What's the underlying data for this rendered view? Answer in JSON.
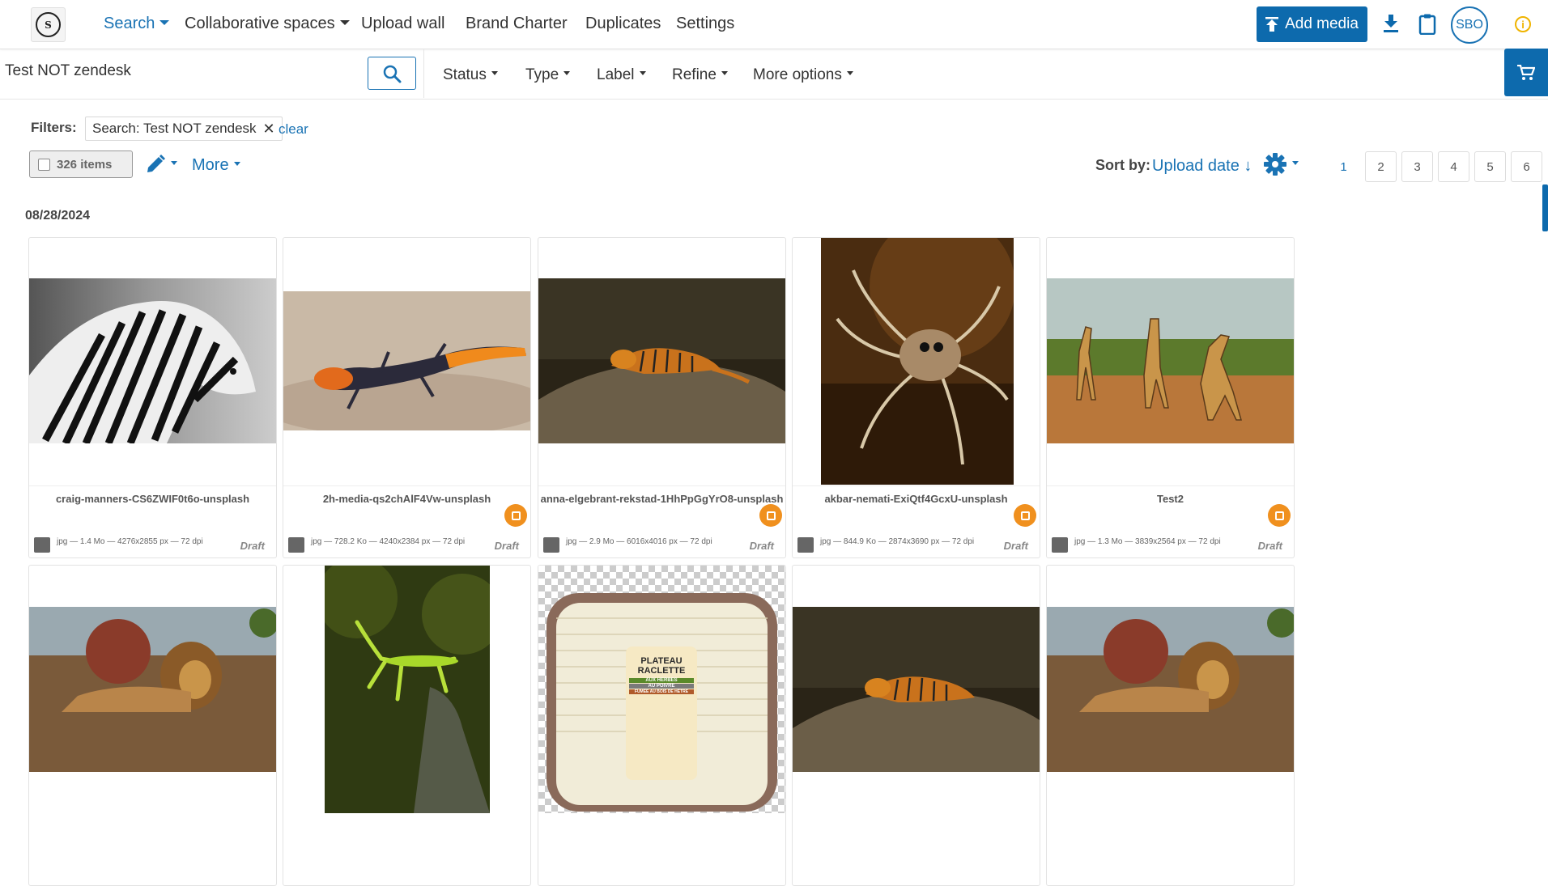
{
  "nav": {
    "items": [
      {
        "label": "Search",
        "dropdown": true,
        "active": true
      },
      {
        "label": "Collaborative spaces",
        "dropdown": true,
        "active": false
      },
      {
        "label": "Upload wall",
        "dropdown": false,
        "active": false
      },
      {
        "label": "Brand Charter",
        "dropdown": false,
        "active": false
      },
      {
        "label": "Duplicates",
        "dropdown": false,
        "active": false
      },
      {
        "label": "Settings",
        "dropdown": false,
        "active": false
      }
    ],
    "add_media_label": "Add media",
    "avatar_initials": "SBO",
    "icons": [
      "upload-icon",
      "download-icon",
      "clipboard-icon",
      "info-icon"
    ]
  },
  "search": {
    "query": "Test NOT zendesk",
    "dropdowns": [
      "Status",
      "Type",
      "Label",
      "Refine",
      "More options"
    ]
  },
  "filters": {
    "label": "Filters:",
    "chips": [
      "Search: Test NOT zendesk"
    ],
    "clear_label": "clear"
  },
  "toolbar": {
    "items_count": "326 items",
    "more_label": "More",
    "sort_label": "Sort by:",
    "sort_value": "Upload date ↓",
    "pages": [
      "1",
      "2",
      "3",
      "4",
      "5",
      "6"
    ],
    "current_page": "1"
  },
  "groups": [
    {
      "date": "08/28/2024",
      "assets": [
        {
          "name": "craig-manners-CS6ZWIF0t6o-unsplash",
          "meta": "jpg — 1.4 Mo — 4276x2855 px — 72 dpi",
          "status": "Draft",
          "badge": false,
          "subject": "zebra"
        },
        {
          "name": "2h-media-qs2chAlF4Vw-unsplash",
          "meta": "jpg — 728.2 Ko — 4240x2384 px — 72 dpi",
          "status": "Draft",
          "badge": true,
          "subject": "lizard"
        },
        {
          "name": "anna-elgebrant-rekstad-1HhPpGgYrO8-unsplash",
          "meta": "jpg — 2.9 Mo — 6016x4016 px — 72 dpi",
          "status": "Draft",
          "badge": true,
          "subject": "tiger"
        },
        {
          "name": "akbar-nemati-ExiQtf4GcxU-unsplash",
          "meta": "jpg — 844.9 Ko — 2874x3690 px — 72 dpi",
          "status": "Draft",
          "badge": true,
          "subject": "spider"
        },
        {
          "name": "Test2",
          "meta": "jpg — 1.3 Mo — 3839x2564 px — 72 dpi",
          "status": "Draft",
          "badge": true,
          "subject": "giraffes"
        },
        {
          "name": "",
          "meta": "",
          "status": "",
          "badge": false,
          "subject": "lion"
        },
        {
          "name": "",
          "meta": "",
          "status": "",
          "badge": false,
          "subject": "mantis"
        },
        {
          "name": "",
          "meta": "",
          "status": "",
          "badge": false,
          "subject": "cheese-package"
        },
        {
          "name": "",
          "meta": "",
          "status": "",
          "badge": false,
          "subject": "tiger"
        },
        {
          "name": "",
          "meta": "",
          "status": "",
          "badge": false,
          "subject": "lion"
        }
      ]
    }
  ],
  "package_text": {
    "line1": "PLATEAU",
    "line2": "RACLETTE",
    "band1": "AUX HERBES",
    "band2": "AU POIVRE",
    "band3": "FUMÉE AU BOIS DE HÊTRE"
  },
  "colors": {
    "primary": "#0d6aad",
    "link": "#1a73b4",
    "badge": "#f0901e",
    "info": "#f0b400"
  }
}
